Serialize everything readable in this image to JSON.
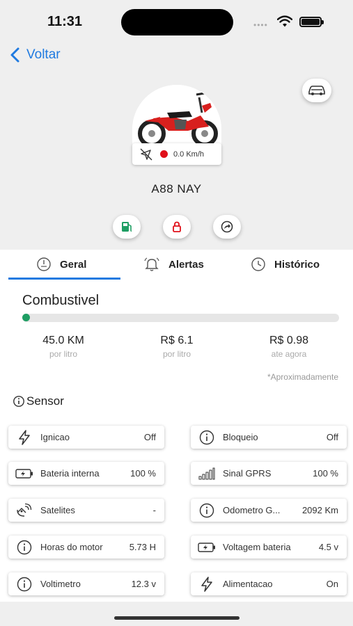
{
  "status_bar": {
    "time": "11:31"
  },
  "nav": {
    "back_label": "Voltar"
  },
  "vehicle": {
    "speed": "0.0 Km/h",
    "plate": "A88 NAY"
  },
  "tabs": [
    {
      "label": "Geral",
      "icon": "gauge-icon",
      "active": true
    },
    {
      "label": "Alertas",
      "icon": "bell-icon",
      "active": false
    },
    {
      "label": "Histórico",
      "icon": "clock-icon",
      "active": false
    }
  ],
  "fuel": {
    "title": "Combustivel",
    "level": 0.0,
    "stats": [
      {
        "value": "45.0 KM",
        "sub": "por litro"
      },
      {
        "value": "R$ 6.1",
        "sub": "por litro"
      },
      {
        "value": "R$ 0.98",
        "sub": "ate agora"
      }
    ],
    "note": "*Aproximadamente"
  },
  "sensor": {
    "title": "Sensor",
    "cards": [
      {
        "label": "Ignicao",
        "value": "Off",
        "icon": "lightning-icon"
      },
      {
        "label": "Bloqueio",
        "value": "Off",
        "icon": "info-icon"
      },
      {
        "label": "Bateria interna",
        "value": "100 %",
        "icon": "battery-icon"
      },
      {
        "label": "Sinal GPRS",
        "value": "100 %",
        "icon": "signal-bars-icon"
      },
      {
        "label": "Satelites",
        "value": "-",
        "icon": "satellite-icon"
      },
      {
        "label": "Odometro G...",
        "value": "2092 Km",
        "icon": "info-icon"
      },
      {
        "label": "Horas do motor",
        "value": "5.73 H",
        "icon": "info-icon"
      },
      {
        "label": "Voltagem bateria",
        "value": "4.5 v",
        "icon": "battery-icon"
      },
      {
        "label": "Voltimetro",
        "value": "12.3 v",
        "icon": "info-icon"
      },
      {
        "label": "Alimentacao",
        "value": "On",
        "icon": "lightning-icon"
      }
    ]
  },
  "colors": {
    "accent": "#1f7ae0",
    "fuel_green": "#1e9e63",
    "danger": "#e0101a"
  }
}
